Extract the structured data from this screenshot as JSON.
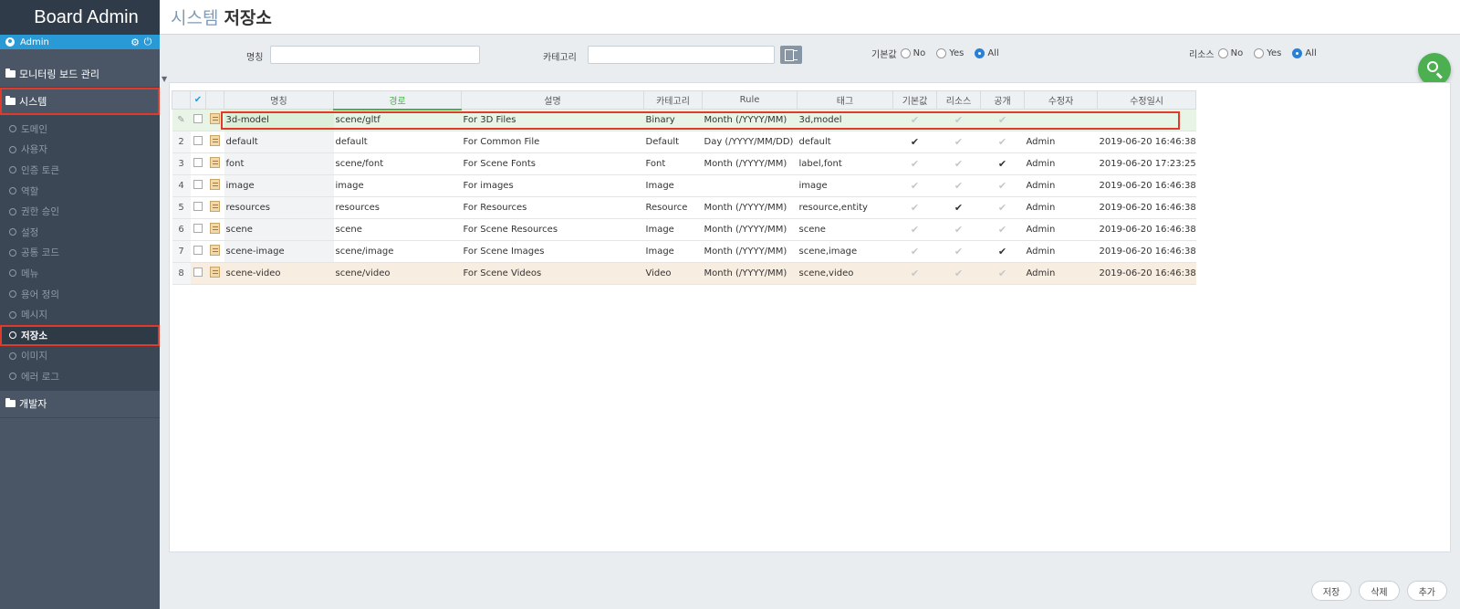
{
  "app": {
    "brand": "Board Admin"
  },
  "user": {
    "name": "Admin"
  },
  "sidebar": {
    "groups": [
      {
        "label": "모니터링 보드 관리"
      },
      {
        "label": "시스템"
      },
      {
        "label": "개발자"
      }
    ],
    "items": [
      {
        "label": "도메인"
      },
      {
        "label": "사용자"
      },
      {
        "label": "인증 토큰"
      },
      {
        "label": "역할"
      },
      {
        "label": "권한 승인"
      },
      {
        "label": "설정"
      },
      {
        "label": "공통 코드"
      },
      {
        "label": "메뉴"
      },
      {
        "label": "용어 정의"
      },
      {
        "label": "메시지"
      },
      {
        "label": "저장소"
      },
      {
        "label": "이미지"
      },
      {
        "label": "에러 로그"
      }
    ]
  },
  "page": {
    "title_prefix": "시스템",
    "title": "저장소"
  },
  "search": {
    "name_label": "명칭",
    "category_label": "카테고리",
    "default_label": "기본값",
    "resource_label": "리소스",
    "opt_no": "No",
    "opt_yes": "Yes",
    "opt_all": "All"
  },
  "grid": {
    "headers": [
      "명칭",
      "경로",
      "설명",
      "카테고리",
      "Rule",
      "태그",
      "기본값",
      "리소스",
      "공개",
      "수정자",
      "수정일시"
    ],
    "rows": [
      {
        "no": "",
        "name": "3d-model",
        "path": "scene/gltf",
        "desc": "For 3D Files",
        "category": "Binary",
        "rule": "Month (/YYYY/MM)",
        "tags": "3d,model",
        "default": false,
        "resource": false,
        "public": false,
        "updater": "",
        "updated": ""
      },
      {
        "no": "2",
        "name": "default",
        "path": "default",
        "desc": "For Common File",
        "category": "Default",
        "rule": "Day (/YYYY/MM/DD)",
        "tags": "default",
        "default": true,
        "resource": false,
        "public": false,
        "updater": "Admin",
        "updated": "2019-06-20 16:46:38"
      },
      {
        "no": "3",
        "name": "font",
        "path": "scene/font",
        "desc": "For Scene Fonts",
        "category": "Font",
        "rule": "Month (/YYYY/MM)",
        "tags": "label,font",
        "default": false,
        "resource": false,
        "public": true,
        "updater": "Admin",
        "updated": "2019-06-20 17:23:25"
      },
      {
        "no": "4",
        "name": "image",
        "path": "image",
        "desc": "For images",
        "category": "Image",
        "rule": "",
        "tags": "image",
        "default": false,
        "resource": false,
        "public": false,
        "updater": "Admin",
        "updated": "2019-06-20 16:46:38"
      },
      {
        "no": "5",
        "name": "resources",
        "path": "resources",
        "desc": "For Resources",
        "category": "Resource",
        "rule": "Month (/YYYY/MM)",
        "tags": "resource,entity",
        "default": false,
        "resource": true,
        "public": false,
        "updater": "Admin",
        "updated": "2019-06-20 16:46:38"
      },
      {
        "no": "6",
        "name": "scene",
        "path": "scene",
        "desc": "For Scene Resources",
        "category": "Image",
        "rule": "Month (/YYYY/MM)",
        "tags": "scene",
        "default": false,
        "resource": false,
        "public": false,
        "updater": "Admin",
        "updated": "2019-06-20 16:46:38"
      },
      {
        "no": "7",
        "name": "scene-image",
        "path": "scene/image",
        "desc": "For Scene Images",
        "category": "Image",
        "rule": "Month (/YYYY/MM)",
        "tags": "scene,image",
        "default": false,
        "resource": false,
        "public": true,
        "updater": "Admin",
        "updated": "2019-06-20 16:46:38"
      },
      {
        "no": "8",
        "name": "scene-video",
        "path": "scene/video",
        "desc": "For Scene Videos",
        "category": "Video",
        "rule": "Month (/YYYY/MM)",
        "tags": "scene,video",
        "default": false,
        "resource": false,
        "public": false,
        "updater": "Admin",
        "updated": "2019-06-20 16:46:38"
      }
    ]
  },
  "actions": {
    "save": "저장",
    "delete": "삭제",
    "add": "추가"
  },
  "icons": {
    "user": "user-circle-icon",
    "settings": "gear-icon",
    "power": "power-icon",
    "search": "search-icon",
    "folder": "folder-icon"
  },
  "colors": {
    "accent": "#2a9ad6",
    "highlight": "#e03a2a",
    "fab": "#4caf50",
    "sidebar": "#4a5665"
  }
}
